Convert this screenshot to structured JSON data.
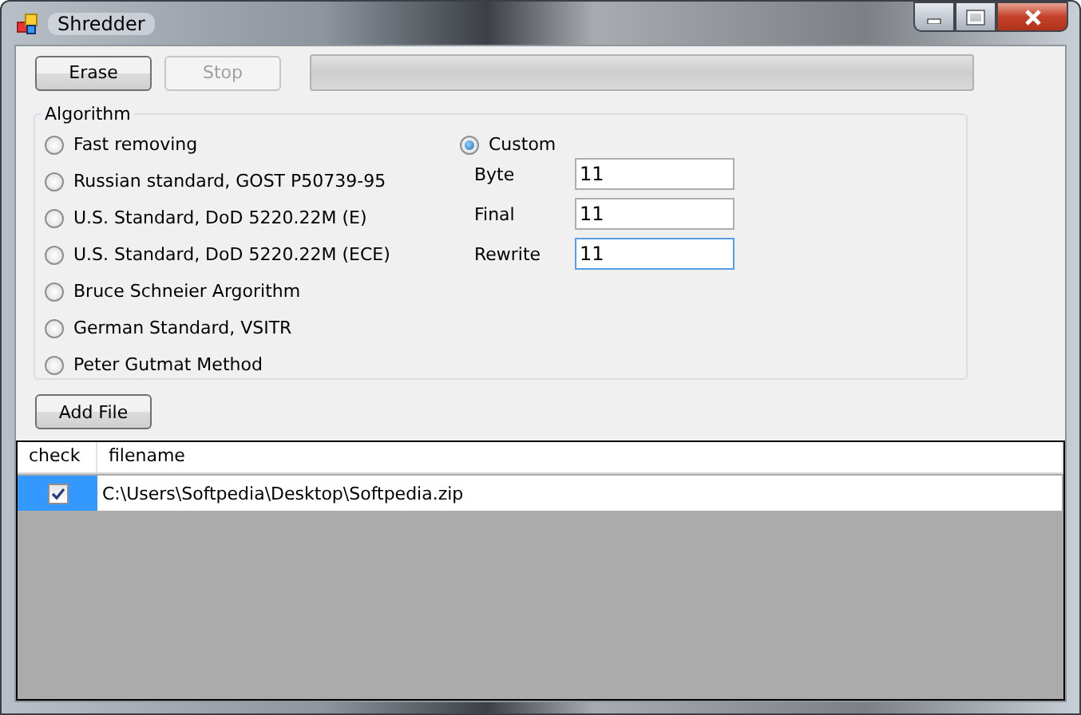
{
  "window": {
    "title": "Shredder"
  },
  "toolbar": {
    "buttons": [
      {
        "label": "Erase",
        "disabled": false
      },
      {
        "label": "Stop",
        "disabled": true
      }
    ],
    "progress": {
      "level": 0
    }
  },
  "algorithm": {
    "title": "Algorithm",
    "options": [
      {
        "label": "Fast removing",
        "selected": false
      },
      {
        "label": "Russian standard, GOST P50739-95",
        "selected": false
      },
      {
        "label": "U.S. Standard, DoD 5220.22M (E)",
        "selected": false
      },
      {
        "label": "U.S. Standard, DoD 5220.22M (ECE)",
        "selected": false
      },
      {
        "label": "Bruce Schneier Argorithm",
        "selected": false
      },
      {
        "label": "German Standard, VSITR",
        "selected": false
      },
      {
        "label": "Peter Gutmat Method",
        "selected": false
      }
    ],
    "custom": {
      "label": "Custom",
      "selected": true
    },
    "fields": [
      {
        "label": "Byte",
        "value": "11",
        "focused": false
      },
      {
        "label": "Final",
        "value": "11",
        "focused": false
      },
      {
        "label": "Rewrite",
        "value": "11",
        "focused": true
      }
    ]
  },
  "add_button": {
    "label": "Add File"
  },
  "table": {
    "columns": [
      "check",
      "filename"
    ],
    "rows": [
      {
        "checked": true,
        "selected": true,
        "filename": "C:\\Users\\Softpedia\\Desktop\\Softpedia.zip"
      }
    ]
  }
}
